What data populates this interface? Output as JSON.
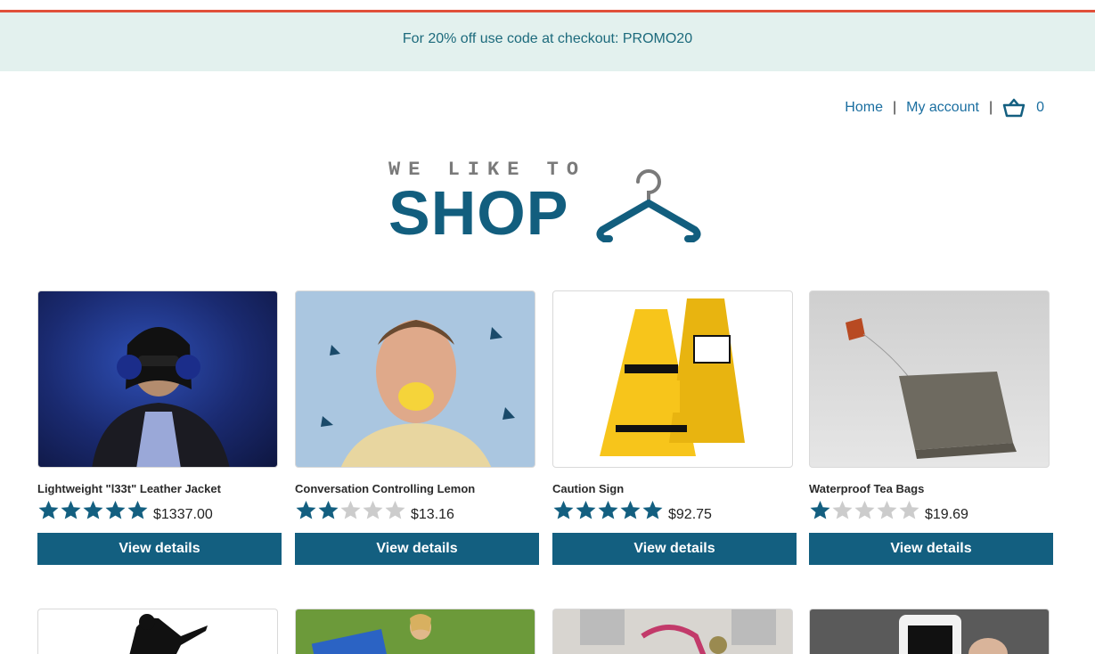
{
  "promo": {
    "text": "For 20% off use code at checkout: PROMO20"
  },
  "nav": {
    "home": "Home",
    "separator": "|",
    "account": "My account",
    "cart_count": "0"
  },
  "logo": {
    "small_text": "WE LIKE TO",
    "big_text": "SHOP"
  },
  "colors": {
    "primary": "#135f80",
    "star_filled": "#135f80",
    "star_empty": "#cccccc",
    "promo_bg": "#e3f1ee",
    "top_accent": "#e0503a"
  },
  "products": [
    {
      "name": "Lightweight \"l33t\" Leather Jacket",
      "price": "$1337.00",
      "rating": 5,
      "button": "View details"
    },
    {
      "name": "Conversation Controlling Lemon",
      "price": "$13.16",
      "rating": 2,
      "button": "View details"
    },
    {
      "name": "Caution Sign",
      "price": "$92.75",
      "rating": 5,
      "button": "View details"
    },
    {
      "name": "Waterproof Tea Bags",
      "price": "$19.69",
      "rating": 1,
      "button": "View details"
    }
  ]
}
